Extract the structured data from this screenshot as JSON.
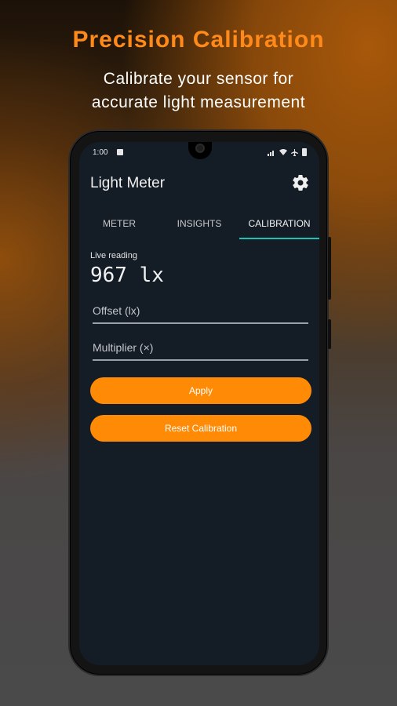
{
  "promo": {
    "headline": "Precision Calibration",
    "subline_1": "Calibrate your sensor for",
    "subline_2": "accurate light measurement"
  },
  "status_bar": {
    "time": "1:00"
  },
  "app": {
    "title": "Light Meter",
    "settings_icon": "gear-icon"
  },
  "tabs": [
    {
      "label": "METER",
      "active": false
    },
    {
      "label": "INSIGHTS",
      "active": false
    },
    {
      "label": "CALIBRATION",
      "active": true
    }
  ],
  "calibration": {
    "live_label": "Live reading",
    "live_value": "967 lx",
    "offset_placeholder": "Offset (lx)",
    "multiplier_placeholder": "Multiplier (×)",
    "apply_label": "Apply",
    "reset_label": "Reset Calibration"
  },
  "colors": {
    "accent": "#ff8a06",
    "tab_indicator": "#20c2b6",
    "screen_bg": "#141c26"
  }
}
